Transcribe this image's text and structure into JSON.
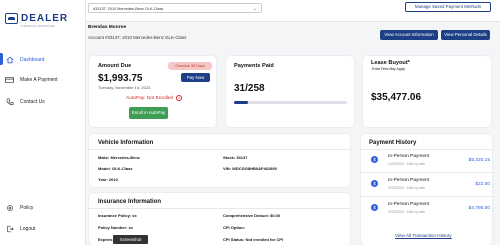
{
  "brand": {
    "name": "DEALER",
    "tagline": "FINANCIAL SOLUTIONS"
  },
  "sidebar": {
    "items": [
      {
        "label": "Dashboard",
        "icon": "home-icon",
        "active": true
      },
      {
        "label": "Make A Payment",
        "icon": "card-icon",
        "active": false
      },
      {
        "label": "Contact Us",
        "icon": "phone-icon",
        "active": false
      },
      {
        "label": "Policy",
        "icon": "settings-icon",
        "active": false
      },
      {
        "label": "Logout",
        "icon": "logout-icon",
        "active": false
      }
    ]
  },
  "topbar": {
    "vehicle_select_value": "#33137: 2010 Mercedes-Benz GLK-Class",
    "manage_button": "Manage Saved Payment Methods"
  },
  "account": {
    "name": "Brendan Monroe",
    "line": "Account #33137: 2010 Mercedes-Benz GLK-Class",
    "view_info_button": "View Account Information",
    "view_personal_button": "View Personal Details"
  },
  "amount_due": {
    "title": "Amount Due",
    "badge": "Overdue 35 Days",
    "amount": "$1,993.75",
    "date": "Tuesday, November 14, 2023",
    "pay_button": "Pay Now",
    "autopay_status": "AutoPay: Not Enrolled",
    "enroll_button": "Enroll in AutoPay"
  },
  "payments_paid": {
    "title": "Payments Paid",
    "count": "31/258",
    "progress_fraction": 0.12
  },
  "lease_buyout": {
    "title": "Lease Buyout*",
    "note": "Extra Fees May Apply",
    "amount": "$35,477.06"
  },
  "vehicle_info": {
    "title": "Vehicle Information",
    "make": "Make: Mercedes-Benz",
    "stock": "Stock: 33137",
    "model": "Model: GLK-Class",
    "vin": "VIN: WDCGG8HB0AF462890",
    "year": "Year: 2010"
  },
  "insurance_info": {
    "title": "Insurance Information",
    "policy": "Insurance Policy: xx",
    "deduct": "Comprehensive Deduct: $0.00",
    "policy_number": "Policy Number: xx",
    "cpi_option": "CPI Option:",
    "expires": "Expires",
    "cpi_status": "CPI Status: Not enrolled for CPI"
  },
  "payment_history": {
    "title": "Payment History",
    "items": [
      {
        "title": "In-Person Payment",
        "sub": "10/08/2023 · Paid by cash",
        "amount": "$5,320.15"
      },
      {
        "title": "In-Person Payment",
        "sub": "07/30/2023 · Paid by cash",
        "amount": "$22.00"
      },
      {
        "title": "In-Person Payment",
        "sub": "07/30/2023 · Paid by cash",
        "amount": "$4,785.00"
      }
    ],
    "view_all": "View All Transaction History"
  },
  "tooltip": "Screenshot",
  "colors": {
    "accent": "#1d3f86",
    "link": "#2b5fd9",
    "danger": "#d62828",
    "success": "#3f9d55"
  }
}
